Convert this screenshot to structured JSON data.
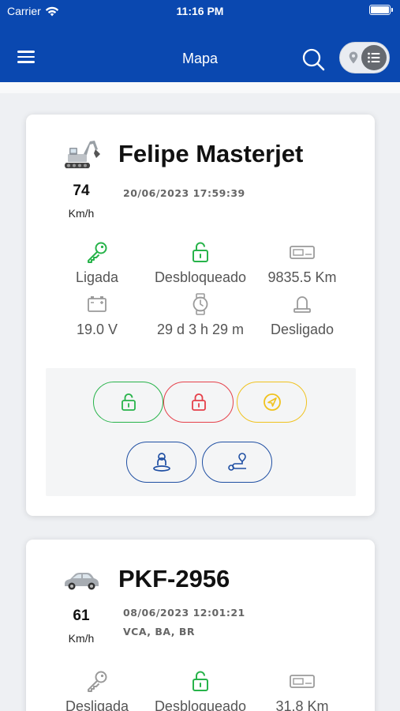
{
  "status_bar": {
    "carrier": "Carrier",
    "time": "11:16 PM"
  },
  "header": {
    "title": "Mapa"
  },
  "colors": {
    "header_bg": "#0a48b0",
    "green": "#27b34a",
    "red": "#e5404a",
    "yellow": "#f0c21e",
    "blue": "#1f4fa3",
    "gray_icon": "#9a9a9a"
  },
  "vehicles": [
    {
      "icon": "excavator-icon",
      "name": "Felipe Masterjet",
      "speed": "74",
      "speed_unit": "Km/h",
      "timestamp": "20/06/2023 17:59:39",
      "location": "",
      "metrics": {
        "ignition": {
          "icon": "key-icon",
          "value": "Ligada"
        },
        "lock": {
          "icon": "unlock-icon",
          "value": "Desbloqueado"
        },
        "odometer": {
          "icon": "odometer-icon",
          "value": "9835.5 Km"
        },
        "battery": {
          "icon": "battery-icon",
          "value": "19.0 V"
        },
        "runtime": {
          "icon": "watch-icon",
          "value": "29 d 3 h 29 m"
        },
        "alarm": {
          "icon": "siren-icon",
          "value": "Desligado"
        }
      },
      "actions": [
        {
          "name": "unlock",
          "icon": "unlock-icon"
        },
        {
          "name": "lock",
          "icon": "lock-icon"
        },
        {
          "name": "navigate",
          "icon": "navigation-icon"
        },
        {
          "name": "driver",
          "icon": "driver-location-icon"
        },
        {
          "name": "route",
          "icon": "route-icon"
        }
      ]
    },
    {
      "icon": "car-icon",
      "name": "PKF-2956",
      "speed": "61",
      "speed_unit": "Km/h",
      "timestamp": "08/06/2023 12:01:21",
      "location": "VCA, BA, BR",
      "metrics": {
        "ignition": {
          "icon": "key-icon",
          "value": "Desligada"
        },
        "lock": {
          "icon": "unlock-icon",
          "value": "Desbloqueado"
        },
        "odometer": {
          "icon": "odometer-icon",
          "value": "31.8 Km"
        }
      }
    }
  ]
}
